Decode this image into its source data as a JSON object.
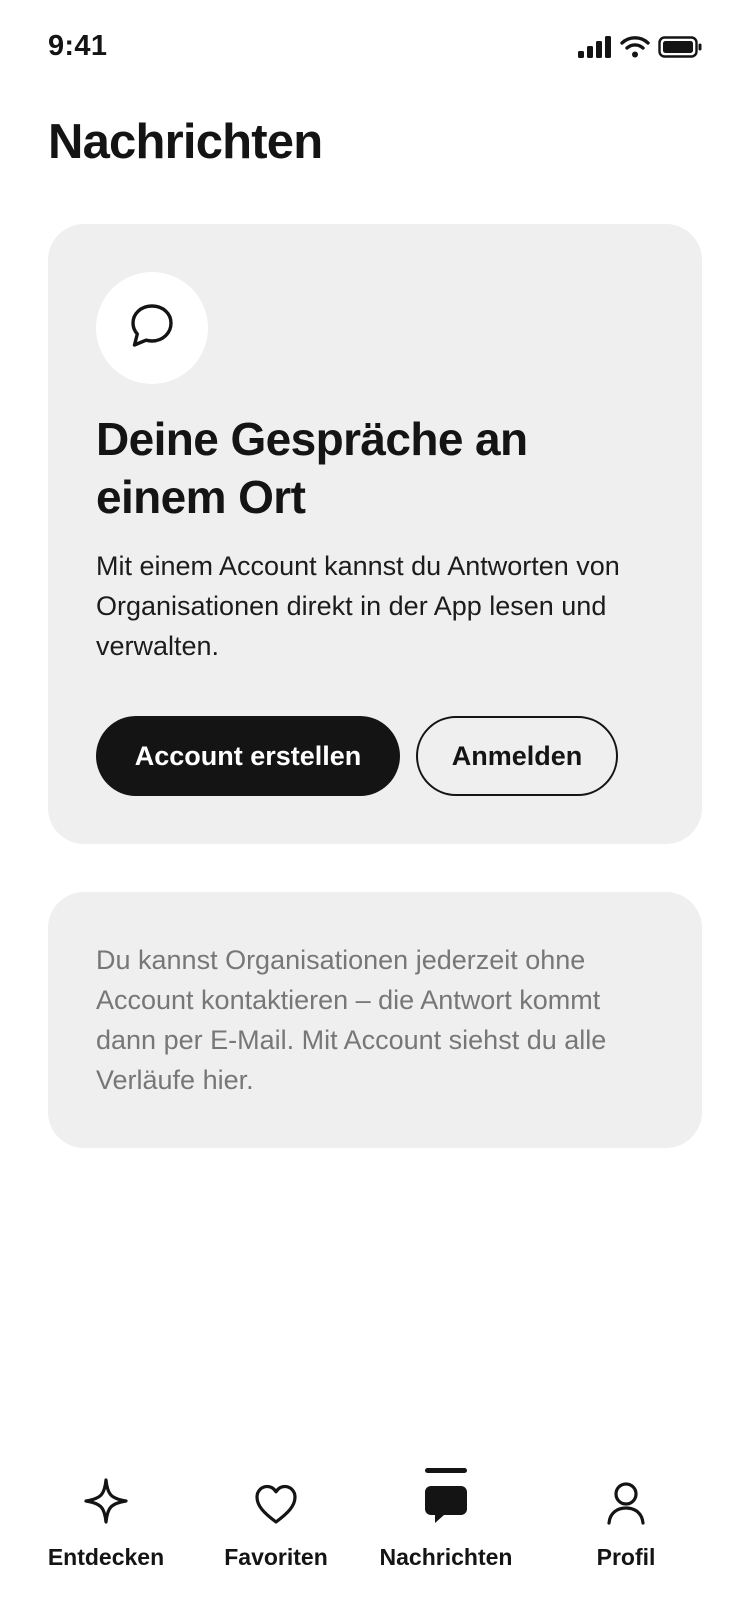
{
  "status_bar": {
    "time": "9:41",
    "icons": [
      "signal-icon",
      "wifi-icon",
      "battery-icon"
    ]
  },
  "header": {
    "title": "Nachrichten"
  },
  "main_card": {
    "icon": "chat-bubble-icon",
    "heading": "Deine Gespräche an einem Ort",
    "text": "Mit einem Account kannst du Antworten von Organisationen direkt in der App lesen und verwalten.",
    "primary_button": "Account erstellen",
    "secondary_button": "Anmelden"
  },
  "info_card": {
    "text": "Du kannst Organisationen jederzeit ohne Account kontaktieren – die Antwort kommt dann per E-Mail. Mit Account siehst du alle Verläufe hier."
  },
  "tab_bar": {
    "tabs": [
      {
        "label": "Entdecken",
        "icon": "sparkle-icon",
        "active": false
      },
      {
        "label": "Favoriten",
        "icon": "heart-icon",
        "active": false
      },
      {
        "label": "Nachrichten",
        "icon": "chat-bubble-filled-icon",
        "active": true
      },
      {
        "label": "Profil",
        "icon": "person-icon",
        "active": false
      }
    ]
  },
  "colors": {
    "text": "#141414",
    "card_bg": "#efefef",
    "muted_text": "#777777",
    "background": "#ffffff"
  }
}
